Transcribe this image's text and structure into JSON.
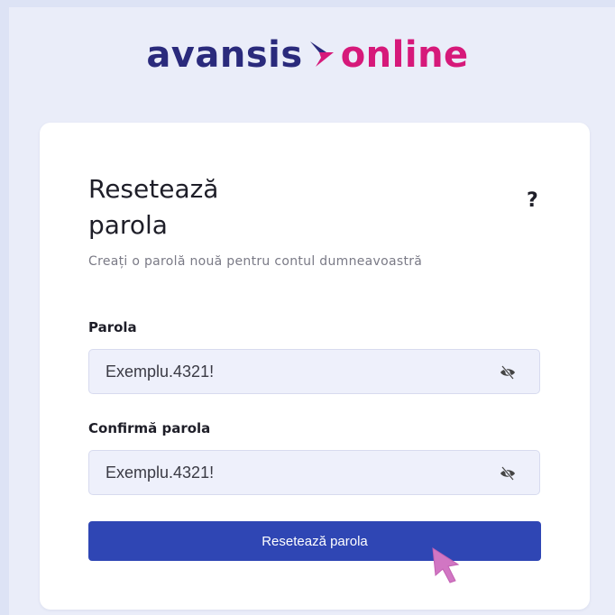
{
  "logo": {
    "part1": "avansis",
    "part2": "online"
  },
  "card": {
    "title": "Resetează parola",
    "help": "?",
    "subtitle": "Creați o parolă nouă pentru contul dumneavoastră"
  },
  "fields": {
    "password": {
      "label": "Parola",
      "value": "Exemplu.4321!",
      "icon": "eye-slash-icon"
    },
    "confirm": {
      "label": "Confirmă parola",
      "value": "Exemplu.4321!",
      "icon": "eye-slash-icon"
    }
  },
  "submit": {
    "label": "Resetează parola"
  },
  "colors": {
    "brand_navy": "#2a2a7c",
    "brand_magenta": "#d6197a",
    "button": "#2f46b4",
    "cursor": "#d176c3"
  }
}
